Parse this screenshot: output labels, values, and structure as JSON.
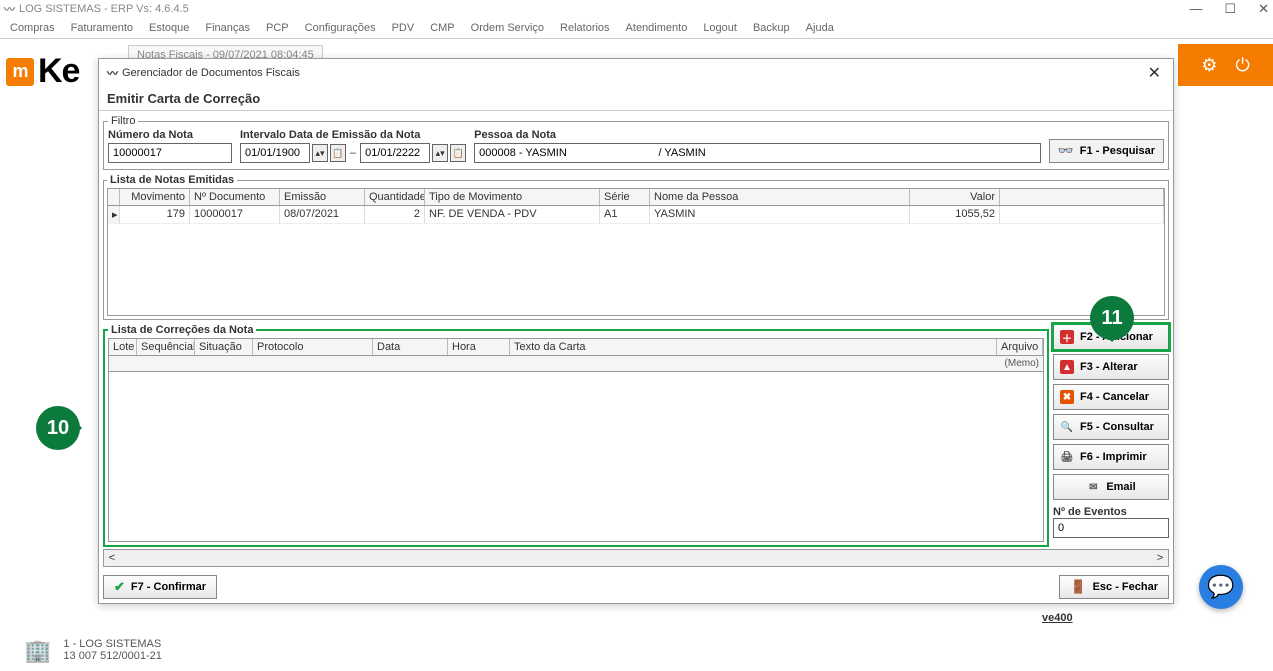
{
  "app": {
    "title": "LOG SISTEMAS - ERP Vs: 4.6.4.5"
  },
  "menubar": [
    "Compras",
    "Faturamento",
    "Estoque",
    "Finanças",
    "PCP",
    "Configurações",
    "PDV",
    "CMP",
    "Ordem Serviço",
    "Relatorios",
    "Atendimento",
    "Logout",
    "Backup",
    "Ajuda"
  ],
  "notas_tab": "Notas Fiscais - 09/07/2021  08:04:45",
  "dialog": {
    "title": "Gerenciador de Documentos Fiscais",
    "subtitle": "Emitir Carta de Correção"
  },
  "filtro": {
    "legend": "Filtro",
    "numero_label": "Número da Nota",
    "numero_value": "10000017",
    "intervalo_label": "Intervalo Data de Emissão da Nota",
    "data_de": "01/01/1900",
    "data_ate": "01/01/2222",
    "pessoa_label": "Pessoa da Nota",
    "pessoa_value": "000008 - YASMIN                              / YASMIN",
    "pesquisar": "F1 - Pesquisar"
  },
  "lista": {
    "legend": "Lista de Notas Emitidas",
    "headers": {
      "mov": "Movimento",
      "doc": "Nº Documento",
      "emis": "Emissão",
      "qtd": "Quantidade",
      "tmv": "Tipo de Movimento",
      "ser": "Série",
      "pes": "Nome da Pessoa",
      "val": "Valor"
    },
    "row": {
      "mov": "179",
      "doc": "10000017",
      "emis": "08/07/2021",
      "qtd": "2",
      "tmv": "NF. DE VENDA - PDV",
      "ser": "A1",
      "pes": "YASMIN",
      "val": "1055,52"
    }
  },
  "correcoes": {
    "legend": "Lista de Correções da Nota",
    "headers": {
      "lote": "Lote",
      "seq": "Sequêncial",
      "sit": "Situação",
      "prot": "Protocolo",
      "data": "Data",
      "hora": "Hora",
      "texto": "Texto da Carta",
      "arq": "Arquivo"
    },
    "memo": "(Memo)"
  },
  "buttons": {
    "adicionar": "F2 - Adicionar",
    "alterar": "F3 - Alterar",
    "cancelar": "F4 - Cancelar",
    "consultar": "F5 - Consultar",
    "imprimir": "F6 - Imprimir",
    "email": "Email",
    "eventos_label": "Nº de Eventos",
    "eventos_value": "0",
    "confirmar": "F7 - Confirmar",
    "fechar": "Esc - Fechar"
  },
  "callouts": {
    "c10": "10",
    "c11": "11"
  },
  "ve400": "ve400",
  "company": {
    "name": "1 - LOG SISTEMAS",
    "cnpj": "13 007 512/0001-21"
  },
  "colors": {
    "accent": "#f57c00",
    "callout": "#0b7a3c",
    "highlight": "#17a547"
  }
}
